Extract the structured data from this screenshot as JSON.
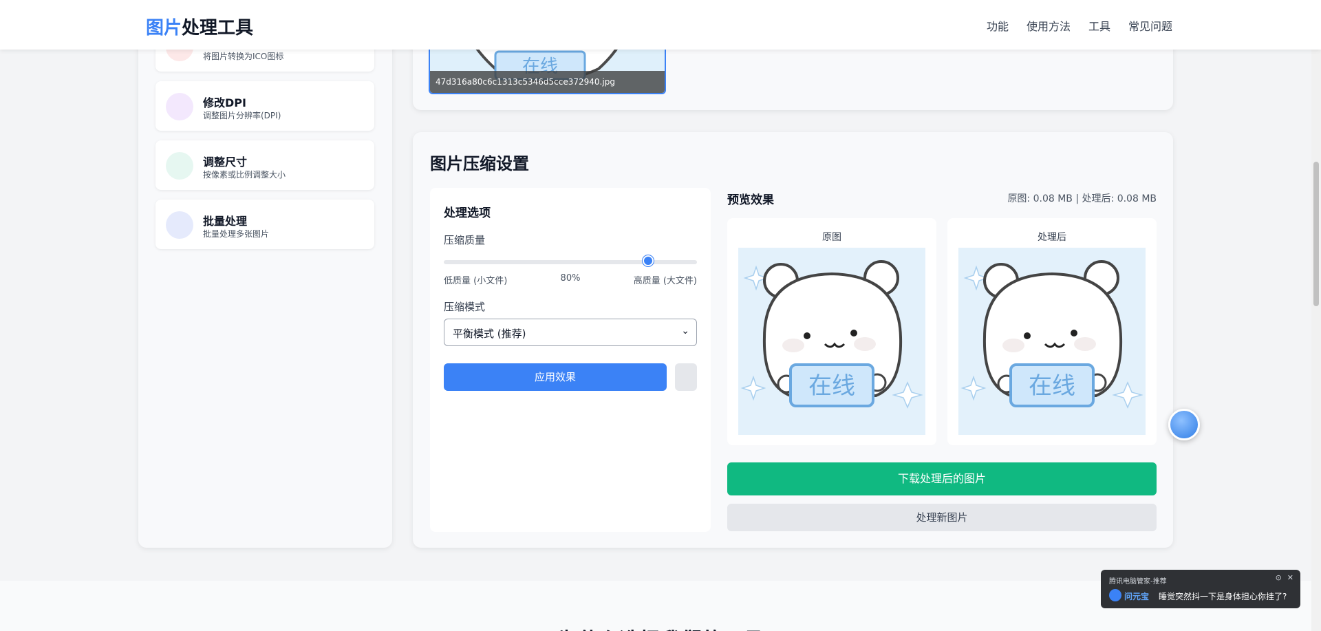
{
  "header": {
    "logo_accent": "图片",
    "logo_rest": "处理工具",
    "nav": [
      "功能",
      "使用方法",
      "工具",
      "常见问题"
    ]
  },
  "sidebar": {
    "tools": [
      {
        "title": "",
        "desc": "将图片转换为ICO图标",
        "color": "#fde8e8"
      },
      {
        "title": "修改DPI",
        "desc": "调整图片分辨率(DPI)",
        "color": "#f3e8fd"
      },
      {
        "title": "调整尺寸",
        "desc": "按像素或比例调整大小",
        "color": "#e6f7f1"
      },
      {
        "title": "批量处理",
        "desc": "批量处理多张图片",
        "color": "#e5eafc"
      }
    ]
  },
  "upload": {
    "filename": "47d316a80c6c1313c5346d5cce372940.jpg"
  },
  "settings": {
    "title": "图片压缩设置",
    "options_title": "处理选项",
    "quality_label": "压缩质量",
    "quality_value": 80,
    "quality_low": "低质量 (小文件)",
    "quality_display": "80%",
    "quality_high": "高质量 (大文件)",
    "mode_label": "压缩模式",
    "mode_selected": "平衡模式 (推荐)",
    "apply_label": "应用效果"
  },
  "preview": {
    "title": "预览效果",
    "size_info": "原图: 0.08 MB | 处理后: 0.08 MB",
    "original_label": "原图",
    "processed_label": "处理后",
    "image_text": "在线",
    "download_label": "下载处理后的图片",
    "new_label": "处理新图片"
  },
  "lower": {
    "heading": "为什么选择我们的工具"
  },
  "popup": {
    "source": "腾讯电脑管家-推荐",
    "brand": "问元宝",
    "message": "睡觉突然抖一下是身体担心你挂了?"
  },
  "colors": {
    "accent": "#3b82f6",
    "download": "#10b981"
  }
}
